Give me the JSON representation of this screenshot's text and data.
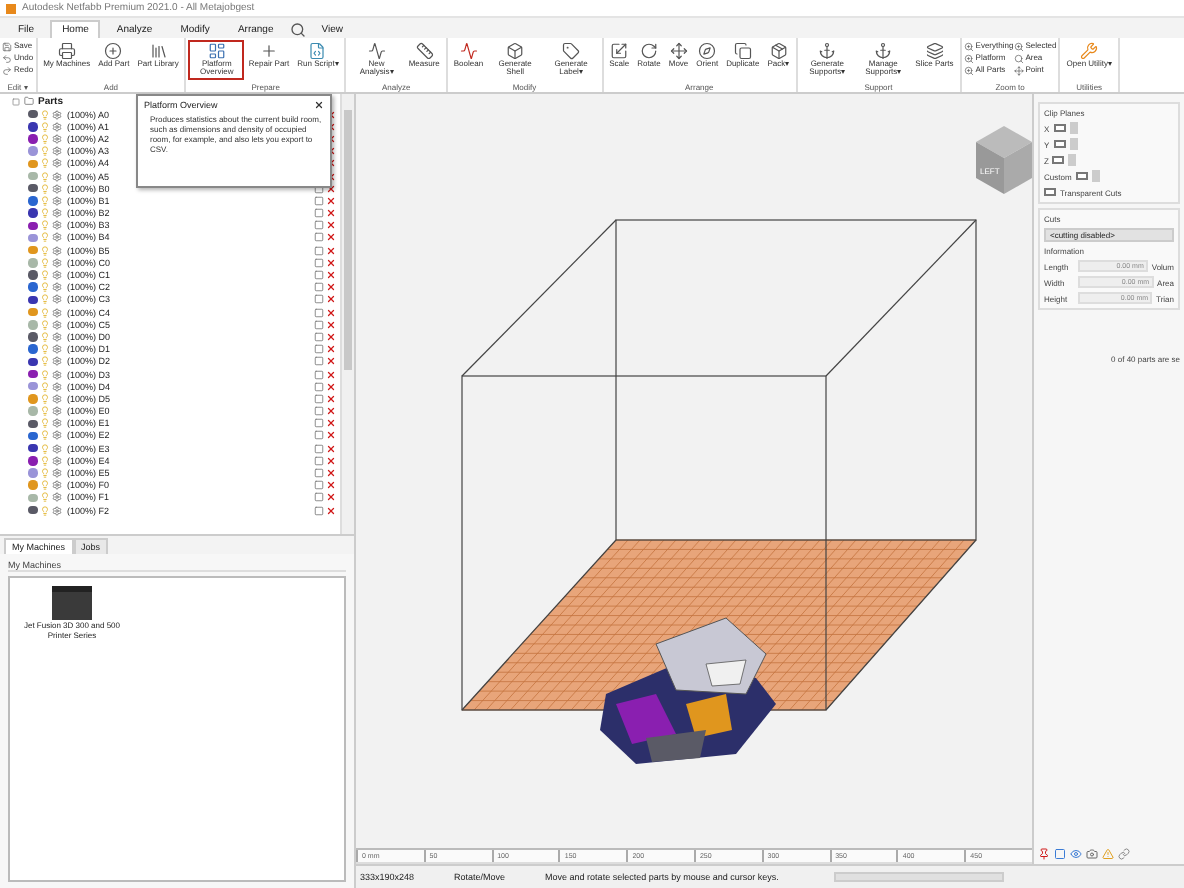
{
  "window": {
    "title": "Autodesk Netfabb Premium 2021.0 - All Metajobgest"
  },
  "menu_tabs": [
    {
      "label": "File",
      "selected": false
    },
    {
      "label": "Home",
      "selected": true
    },
    {
      "label": "Analyze",
      "selected": false
    },
    {
      "label": "Modify",
      "selected": false
    },
    {
      "label": "Arrange",
      "selected": false
    },
    {
      "label": "View",
      "selected": false
    }
  ],
  "ribbon": [
    {
      "label": "Edit ▾",
      "buttons": [
        {
          "label": "Save",
          "kind": "small"
        },
        {
          "label": "Undo",
          "kind": "small"
        },
        {
          "label": "Redo",
          "kind": "small"
        }
      ]
    },
    {
      "label": "Add",
      "buttons": [
        {
          "label": "My Machines",
          "kind": "large"
        },
        {
          "label": "Add Part",
          "kind": "large"
        },
        {
          "label": "Part Library",
          "kind": "large"
        }
      ]
    },
    {
      "label": "Prepare",
      "buttons": [
        {
          "label": "Platform Overview",
          "kind": "large",
          "highlighted": true
        },
        {
          "label": "Repair Part",
          "kind": "large"
        },
        {
          "label": "Run Script▾",
          "kind": "large"
        }
      ]
    },
    {
      "label": "Analyze",
      "buttons": [
        {
          "label": "New Analysis▾",
          "kind": "large"
        },
        {
          "label": "Measure",
          "kind": "large"
        }
      ]
    },
    {
      "label": "Modify",
      "buttons": [
        {
          "label": "Boolean",
          "kind": "large"
        },
        {
          "label": "Generate Shell",
          "kind": "large"
        },
        {
          "label": "Generate Label▾",
          "kind": "large"
        }
      ]
    },
    {
      "label": "Arrange",
      "buttons": [
        {
          "label": "Scale",
          "kind": "large"
        },
        {
          "label": "Rotate",
          "kind": "large"
        },
        {
          "label": "Move",
          "kind": "large"
        },
        {
          "label": "Orient",
          "kind": "large"
        },
        {
          "label": "Duplicate",
          "kind": "large"
        },
        {
          "label": "Pack▾",
          "kind": "large"
        }
      ]
    },
    {
      "label": "Support",
      "buttons": [
        {
          "label": "Generate Supports▾",
          "kind": "large"
        },
        {
          "label": "Manage Supports▾",
          "kind": "large"
        },
        {
          "label": "Slice Parts",
          "kind": "large"
        }
      ]
    },
    {
      "label": "Zoom to",
      "buttons": [
        {
          "label": "Everything",
          "kind": "small"
        },
        {
          "label": "Platform",
          "kind": "small"
        },
        {
          "label": "All Parts",
          "kind": "small"
        },
        {
          "label": "Selected",
          "kind": "small"
        },
        {
          "label": "Area",
          "kind": "small"
        },
        {
          "label": "Point",
          "kind": "small"
        }
      ]
    },
    {
      "label": "Utilities",
      "buttons": [
        {
          "label": "Open Utility▾",
          "kind": "large"
        }
      ]
    }
  ],
  "tooltip": {
    "title": "Platform Overview",
    "text": "Produces statistics about the current build room, such as dimensions and density of occupied room, for example, and also lets you export to CSV."
  },
  "parts": {
    "title": "Parts",
    "items": [
      {
        "label": "(100%) A0",
        "color": "#5a5a66"
      },
      {
        "label": "(100%) A1",
        "color": "#3a36b0"
      },
      {
        "label": "(100%) A2",
        "color": "#8a1fb0"
      },
      {
        "label": "(100%) A3",
        "color": "#9a94d8"
      },
      {
        "label": "(100%) A4",
        "color": "#e0961e"
      },
      {
        "label": "(100%) A5",
        "color": "#a8b8a8"
      },
      {
        "label": "(100%) B0",
        "color": "#5a5a66"
      },
      {
        "label": "(100%) B1",
        "color": "#2a66d0"
      },
      {
        "label": "(100%) B2",
        "color": "#3a36b0"
      },
      {
        "label": "(100%) B3",
        "color": "#8a1fb0"
      },
      {
        "label": "(100%) B4",
        "color": "#9a94d8"
      },
      {
        "label": "(100%) B5",
        "color": "#e0961e"
      },
      {
        "label": "(100%) C0",
        "color": "#a8b8a8"
      },
      {
        "label": "(100%) C1",
        "color": "#5a5a66"
      },
      {
        "label": "(100%) C2",
        "color": "#2a66d0"
      },
      {
        "label": "(100%) C3",
        "color": "#3a36b0"
      },
      {
        "label": "(100%) C4",
        "color": "#e0961e"
      },
      {
        "label": "(100%) C5",
        "color": "#a8b8a8"
      },
      {
        "label": "(100%) D0",
        "color": "#5a5a66"
      },
      {
        "label": "(100%) D1",
        "color": "#2a66d0"
      },
      {
        "label": "(100%) D2",
        "color": "#3a36b0"
      },
      {
        "label": "(100%) D3",
        "color": "#8a1fb0"
      },
      {
        "label": "(100%) D4",
        "color": "#9a94d8"
      },
      {
        "label": "(100%) D5",
        "color": "#e0961e"
      },
      {
        "label": "(100%) E0",
        "color": "#a8b8a8"
      },
      {
        "label": "(100%) E1",
        "color": "#5a5a66"
      },
      {
        "label": "(100%) E2",
        "color": "#2a66d0"
      },
      {
        "label": "(100%) E3",
        "color": "#3a36b0"
      },
      {
        "label": "(100%) E4",
        "color": "#8a1fb0"
      },
      {
        "label": "(100%) E5",
        "color": "#9a94d8"
      },
      {
        "label": "(100%) F0",
        "color": "#e0961e"
      },
      {
        "label": "(100%) F1",
        "color": "#a8b8a8"
      },
      {
        "label": "(100%) F2",
        "color": "#5a5a66"
      }
    ]
  },
  "lower_tabs": [
    {
      "label": "My Machines",
      "selected": true
    },
    {
      "label": "Jobs",
      "selected": false
    }
  ],
  "machines": {
    "title": "My Machines",
    "items": [
      {
        "label": "Jet Fusion 3D 300 and 500 Printer Series"
      }
    ]
  },
  "view_cube": {
    "face": "LEFT"
  },
  "ruler": [
    "0 mm",
    "50",
    "100",
    "150",
    "200",
    "250",
    "300",
    "350",
    "400",
    "450"
  ],
  "right_panel": {
    "clip_title": "Clip Planes",
    "clip_rows": [
      {
        "label": "X",
        "checked": false
      },
      {
        "label": "Y",
        "checked": false
      },
      {
        "label": "Z",
        "checked": false
      },
      {
        "label": "Custom",
        "checked": false
      }
    ],
    "transparent_cuts": {
      "label": "Transparent Cuts",
      "checked": false
    },
    "cuts_label": "Cuts",
    "cuts_value": "<cutting disabled>",
    "info_title": "Information",
    "info_rows": [
      {
        "label": "Length",
        "value": "0.00 mm",
        "extra": "Volum"
      },
      {
        "label": "Width",
        "value": "0.00 mm",
        "extra": "Area"
      },
      {
        "label": "Height",
        "value": "0.00 mm",
        "extra": "Trian"
      }
    ],
    "selection_note": "0 of 40 parts are se"
  },
  "status_bar": {
    "size": "333x190x248",
    "mode": "Rotate/Move",
    "message": "Move and rotate selected parts by mouse and cursor keys."
  }
}
